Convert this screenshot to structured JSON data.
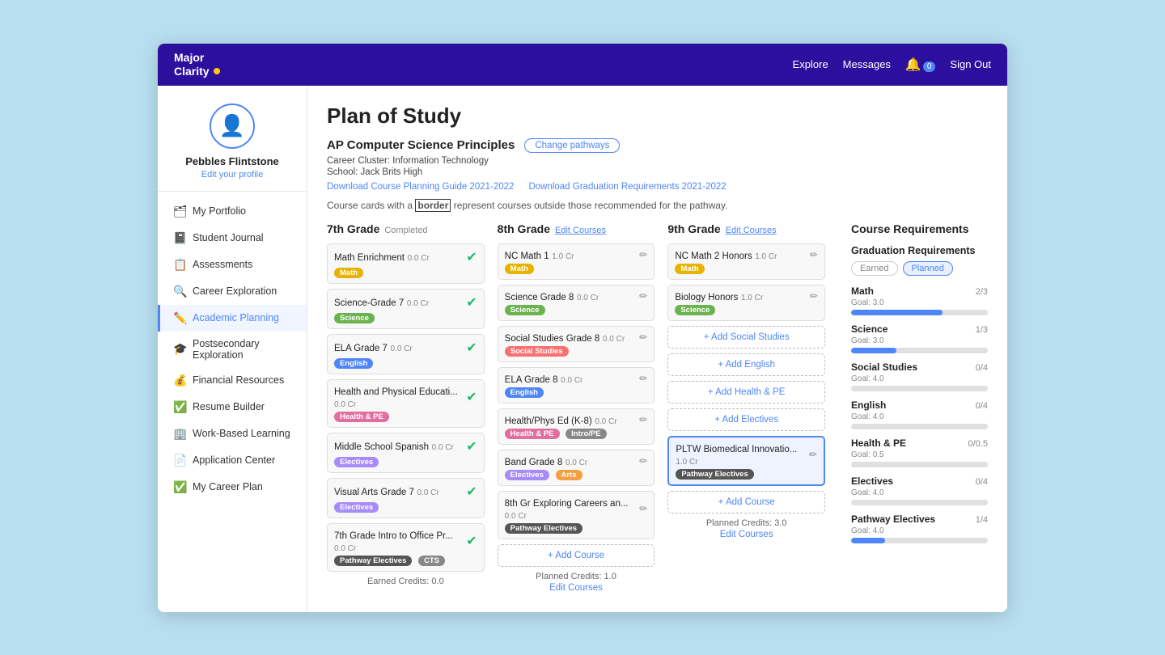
{
  "nav": {
    "logo_line1": "Major",
    "logo_line2": "Clarity",
    "explore": "Explore",
    "messages": "Messages",
    "notification_count": "0",
    "sign_out": "Sign Out"
  },
  "sidebar": {
    "profile_name": "Pebbles Flintstone",
    "edit_profile": "Edit your profile",
    "items": [
      {
        "id": "portfolio",
        "label": "My Portfolio",
        "icon": "🗂"
      },
      {
        "id": "journal",
        "label": "Student Journal",
        "icon": "📓"
      },
      {
        "id": "assessments",
        "label": "Assessments",
        "icon": "📋"
      },
      {
        "id": "career",
        "label": "Career Exploration",
        "icon": "🔍"
      },
      {
        "id": "academic",
        "label": "Academic Planning",
        "icon": "✏️",
        "active": true
      },
      {
        "id": "postsecondary",
        "label": "Postsecondary Exploration",
        "icon": "🎓"
      },
      {
        "id": "financial",
        "label": "Financial Resources",
        "icon": "💰"
      },
      {
        "id": "resume",
        "label": "Resume Builder",
        "icon": "✅"
      },
      {
        "id": "workbased",
        "label": "Work-Based Learning",
        "icon": "🏢"
      },
      {
        "id": "application",
        "label": "Application Center",
        "icon": "📄"
      },
      {
        "id": "careerplan",
        "label": "My Career Plan",
        "icon": "✅"
      }
    ]
  },
  "main": {
    "page_title": "Plan of Study",
    "pathway_name": "AP Computer Science Principles",
    "change_pathway_btn": "Change pathways",
    "career_cluster": "Career Cluster: Information Technology",
    "school": "School: Jack Brits High",
    "download_link1": "Download Course Planning Guide 2021-2022",
    "download_link2": "Download Graduation Requirements 2021-2022",
    "border_note": "Course cards with a border represent courses outside those recommended for the pathway.",
    "grade7": {
      "title": "7th Grade",
      "status": "Completed",
      "courses": [
        {
          "name": "Math Enrichment",
          "credits": "0.0 Cr",
          "tag": "Math",
          "tag_class": "tag-math",
          "completed": true
        },
        {
          "name": "Science-Grade 7",
          "credits": "0.0 Cr",
          "tag": "Science",
          "tag_class": "tag-science",
          "completed": true
        },
        {
          "name": "ELA Grade 7",
          "credits": "0.0 Cr",
          "tag": "English",
          "tag_class": "tag-english",
          "completed": true
        },
        {
          "name": "Health and Physical Educati...",
          "credits": "0.0 Cr",
          "tag": "Health & PE",
          "tag_class": "tag-health",
          "completed": true
        },
        {
          "name": "Middle School Spanish",
          "credits": "0.0 Cr",
          "tag": "Electives",
          "tag_class": "tag-electives",
          "completed": true
        },
        {
          "name": "Visual Arts Grade 7",
          "credits": "0.0 Cr",
          "tag": "Electives",
          "tag_class": "tag-electives",
          "completed": true
        },
        {
          "name": "7th Grade Intro to Office Pr...",
          "credits": "0.0 Cr",
          "tag": "Pathway Electives",
          "tag_class": "tag-pathway",
          "tag2": "CTS",
          "tag2_class": "tag-cts",
          "completed": true
        }
      ],
      "footer": "Earned Credits: 0.0"
    },
    "grade8": {
      "title": "8th Grade",
      "edit_label": "Edit Courses",
      "courses": [
        {
          "name": "NC Math 1",
          "credits": "1.0 Cr",
          "tag": "Math",
          "tag_class": "tag-math"
        },
        {
          "name": "Science Grade 8",
          "credits": "0.0 Cr",
          "tag": "Science",
          "tag_class": "tag-science"
        },
        {
          "name": "Social Studies Grade 8",
          "credits": "0.0 Cr",
          "tag": "Social Studies",
          "tag_class": "tag-social"
        },
        {
          "name": "ELA Grade 8",
          "credits": "0.0 Cr",
          "tag": "English",
          "tag_class": "tag-english"
        },
        {
          "name": "Health/Phys Ed (K-8)",
          "credits": "0.0 Cr",
          "tag": "Health & PE",
          "tag_class": "tag-health",
          "tag2": "Intro/PE",
          "tag2_class": "tag-cts"
        },
        {
          "name": "Band Grade 8",
          "credits": "0.0 Cr",
          "tag": "Electives",
          "tag_class": "tag-electives",
          "tag2": "Arts",
          "tag2_class": "tag-arts"
        },
        {
          "name": "8th Gr Exploring Careers an...",
          "credits": "0.0 Cr",
          "tag": "Pathway Electives",
          "tag_class": "tag-pathway"
        }
      ],
      "add_course": "+ Add Course",
      "footer": "Planned Credits: 1.0",
      "edit_courses_link": "Edit Courses"
    },
    "grade9": {
      "title": "9th Grade",
      "edit_label": "Edit Courses",
      "courses": [
        {
          "name": "NC Math 2 Honors",
          "credits": "1.0 Cr",
          "tag": "Math",
          "tag_class": "tag-math"
        },
        {
          "name": "Biology Honors",
          "credits": "1.0 Cr",
          "tag": "Science",
          "tag_class": "tag-science"
        }
      ],
      "add_items": [
        {
          "label": "+ Add Social Studies"
        },
        {
          "label": "+ Add English"
        },
        {
          "label": "+ Add Health & PE"
        },
        {
          "label": "+ Add Electives"
        }
      ],
      "highlighted_course": {
        "name": "PLTW Biomedical Innovatio...",
        "credits": "1.0 Cr",
        "tag": "Pathway Electives",
        "tag_class": "tag-pathway"
      },
      "add_course": "+ Add Course",
      "footer": "Planned Credits: 3.0",
      "edit_courses_link": "Edit Courses"
    }
  },
  "requirements": {
    "panel_title": "Course Requirements",
    "grad_req_title": "Graduation Requirements",
    "toggle_earned": "Earned",
    "toggle_planned": "Planned",
    "items": [
      {
        "name": "Math",
        "goal": "3.0",
        "earned": "2",
        "total": "3",
        "fill_pct": 67
      },
      {
        "name": "Science",
        "goal": "3.0",
        "earned": "1",
        "total": "3",
        "fill_pct": 33
      },
      {
        "name": "Social Studies",
        "goal": "4.0",
        "earned": "0",
        "total": "4",
        "fill_pct": 0
      },
      {
        "name": "English",
        "goal": "4.0",
        "earned": "0",
        "total": "4",
        "fill_pct": 0
      },
      {
        "name": "Health & PE",
        "goal": "0.5",
        "earned": "0",
        "total": "0.5",
        "fill_pct": 0
      },
      {
        "name": "Electives",
        "goal": "4.0",
        "earned": "0",
        "total": "4",
        "fill_pct": 0
      },
      {
        "name": "Pathway Electives",
        "goal": "4.0",
        "earned": "1",
        "total": "4",
        "fill_pct": 25
      }
    ]
  }
}
